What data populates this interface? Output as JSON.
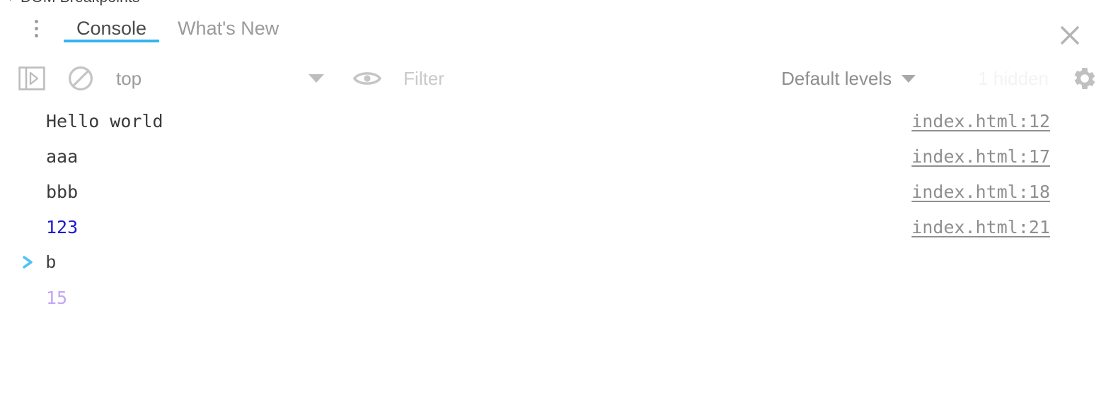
{
  "clipped_panel": {
    "title": "DOM Breakpoints",
    "disclosure_icon": "triangle-right-icon"
  },
  "tabbar": {
    "kebab_icon": "more-options-icon",
    "close_icon": "close-icon",
    "tabs": [
      {
        "label": "Console",
        "active": true
      },
      {
        "label": "What's New",
        "active": false
      }
    ]
  },
  "toolbar": {
    "sidebar_toggle_icon": "show-console-sidebar-icon",
    "clear_icon": "clear-console-icon",
    "context_selector": {
      "value": "top",
      "caret_icon": "chevron-down-icon"
    },
    "eye_icon": "live-expression-icon",
    "filter": {
      "value": "",
      "placeholder": "Filter"
    },
    "levels": {
      "label": "Default levels",
      "caret_icon": "chevron-down-icon"
    },
    "hidden_count": "1 hidden",
    "settings_icon": "gear-icon"
  },
  "console": {
    "messages": [
      {
        "text": "Hello world",
        "kind": "log",
        "source": "index.html:12",
        "chevron": false
      },
      {
        "text": "aaa",
        "kind": "log",
        "source": "index.html:17",
        "chevron": false
      },
      {
        "text": "bbb",
        "kind": "log",
        "source": "index.html:18",
        "chevron": false
      },
      {
        "text": "123",
        "kind": "number",
        "source": "index.html:21",
        "chevron": false
      },
      {
        "text": "b",
        "kind": "input",
        "source": "",
        "chevron": true
      },
      {
        "text": "15",
        "kind": "result",
        "source": "",
        "chevron": false
      }
    ]
  },
  "colors": {
    "accent": "#35b3f0",
    "number": "#1c1ccd",
    "result": "#c3a6f7",
    "link": "#8f8f8f",
    "icon": "#bdbdbd",
    "text": "#3b3b3b"
  }
}
